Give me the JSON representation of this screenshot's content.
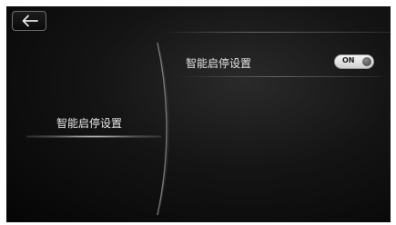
{
  "left_menu": {
    "items": [
      {
        "label": "智能启停设置",
        "selected": true
      }
    ]
  },
  "settings": [
    {
      "label": "智能启停设置",
      "toggle_state": "ON"
    }
  ],
  "icons": {
    "back": "back-arrow-icon",
    "toggle_knob": "toggle-knob-icon"
  },
  "colors": {
    "background": "#0b0b0b",
    "text": "#e6e6e6",
    "toggle_on": "#eeeeee"
  }
}
